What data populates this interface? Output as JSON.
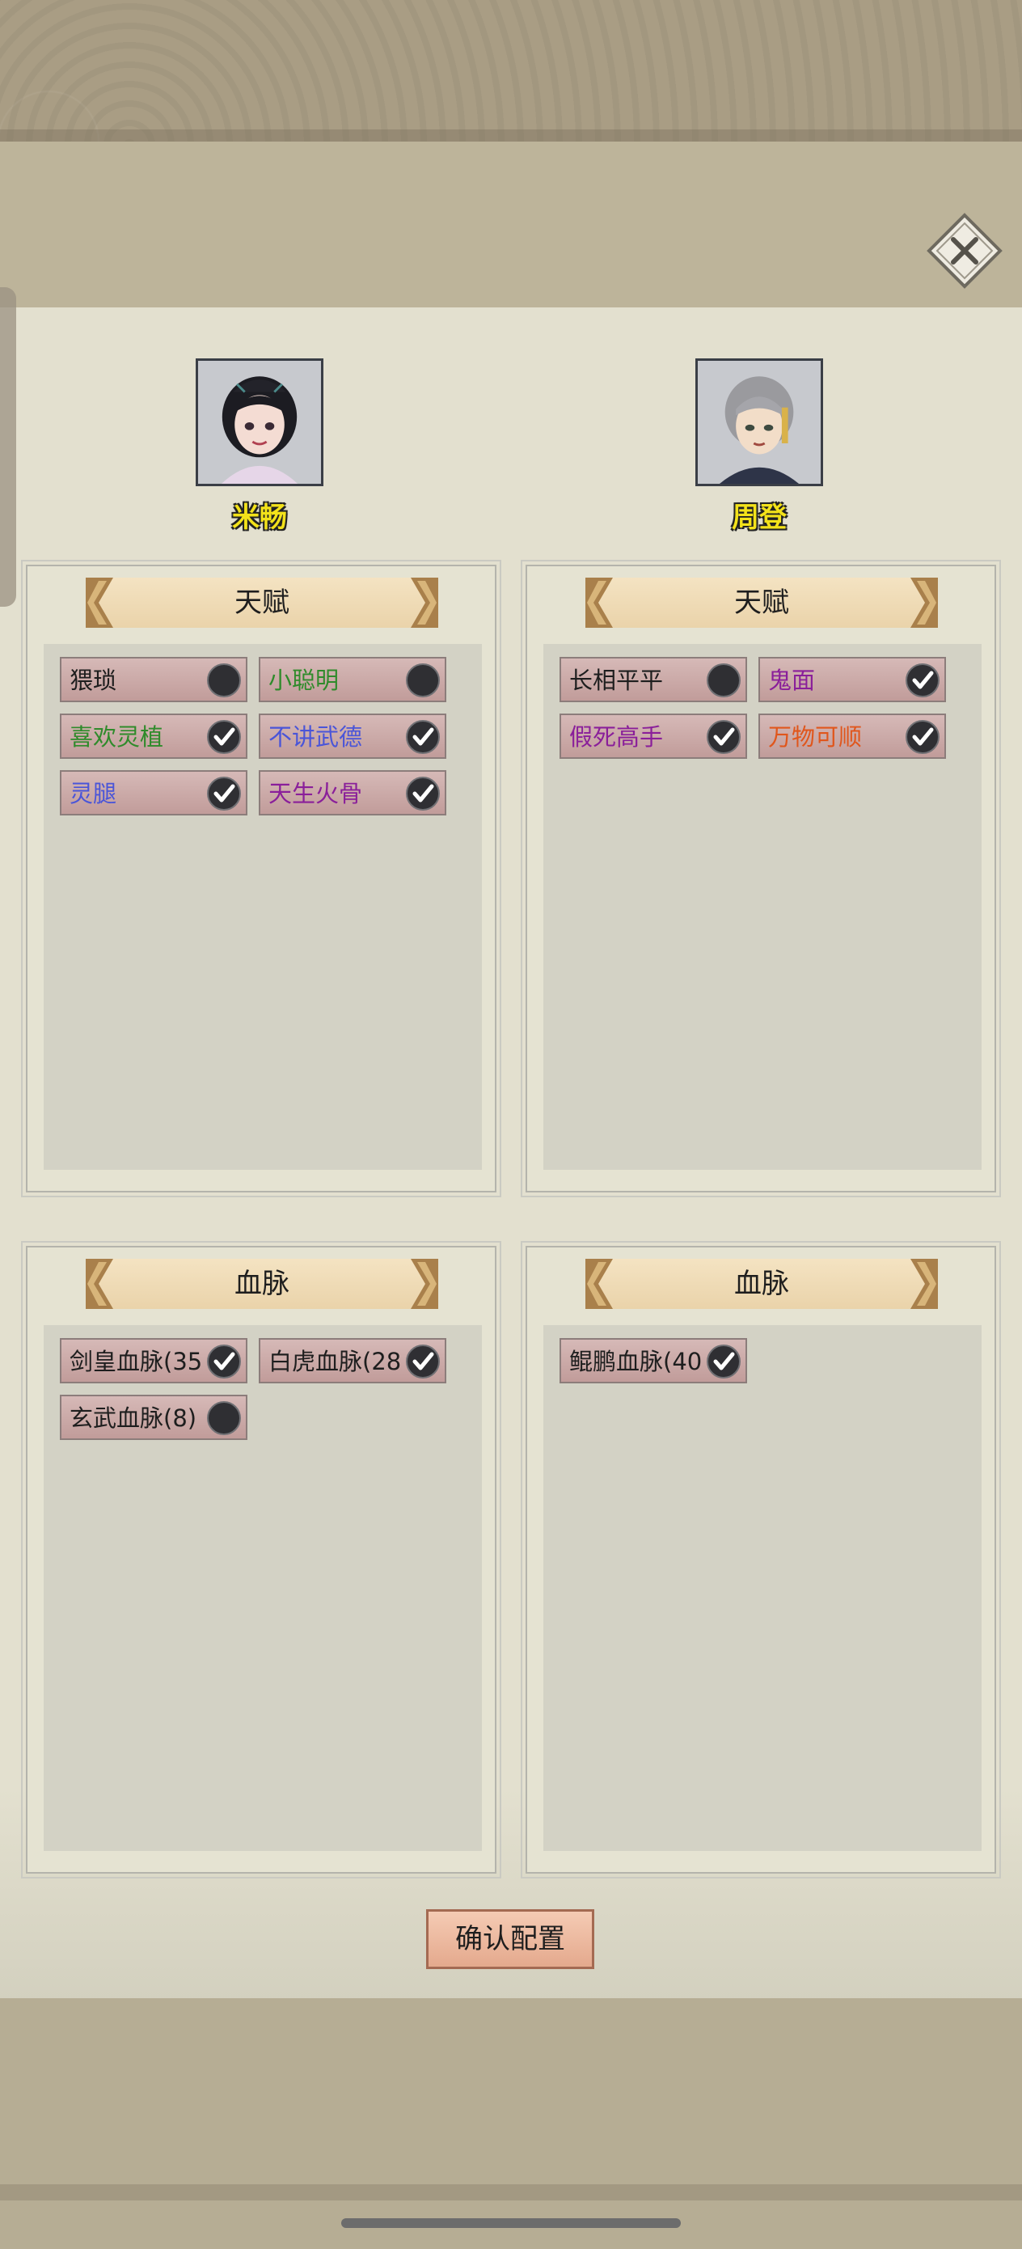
{
  "characters": [
    {
      "name": "米畅",
      "talent_title": "天赋",
      "bloodline_title": "血脉"
    },
    {
      "name": "周登",
      "talent_title": "天赋",
      "bloodline_title": "血脉"
    }
  ],
  "talents": {
    "left": [
      {
        "label": "猥琐",
        "color": "#1e1e1e",
        "checked": false
      },
      {
        "label": "小聪明",
        "color": "#2f8b2b",
        "checked": false
      },
      {
        "label": "喜欢灵植",
        "color": "#2f8b2b",
        "checked": true
      },
      {
        "label": "不讲武德",
        "color": "#4a55d8",
        "checked": true
      },
      {
        "label": "灵腿",
        "color": "#4a55d8",
        "checked": true
      },
      {
        "label": "天生火骨",
        "color": "#8a1f9a",
        "checked": true
      }
    ],
    "right": [
      {
        "label": "长相平平",
        "color": "#1e1e1e",
        "checked": false
      },
      {
        "label": "鬼面",
        "color": "#8a1f9a",
        "checked": true
      },
      {
        "label": "假死高手",
        "color": "#8a1f9a",
        "checked": true
      },
      {
        "label": "万物可顺",
        "color": "#e0561c",
        "checked": true
      }
    ]
  },
  "bloodlines": {
    "left": [
      {
        "label": "剑皇血脉(35",
        "color": "#1e1e1e",
        "checked": true
      },
      {
        "label": "白虎血脉(28",
        "color": "#1e1e1e",
        "checked": true
      },
      {
        "label": "玄武血脉(8)",
        "color": "#1e1e1e",
        "checked": false
      }
    ],
    "right": [
      {
        "label": "鲲鹏血脉(40",
        "color": "#1e1e1e",
        "checked": true
      }
    ]
  },
  "confirm_label": "确认配置",
  "icons": {
    "close": "close-icon",
    "checked": "checkmark-icon",
    "unchecked": "empty-circle-icon"
  }
}
